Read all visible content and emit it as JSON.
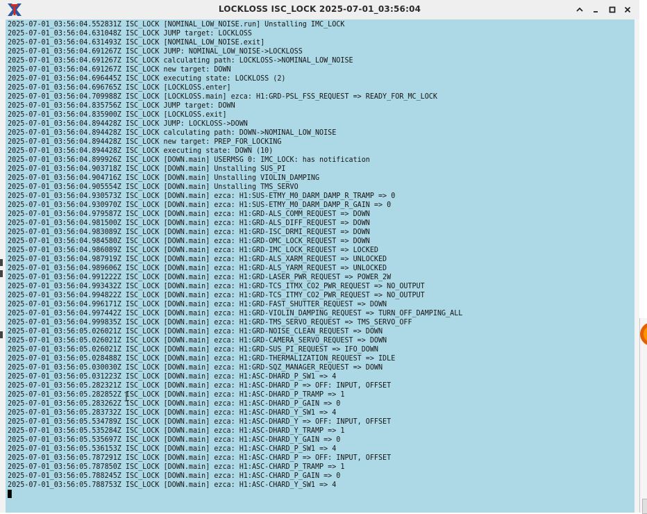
{
  "window": {
    "title": "LOCKLOSS ISC_LOCK 2025-07-01_03:56:04",
    "icons": {
      "app": "x-terminal-icon",
      "collapse": "chevron-up-icon",
      "minimize": "minimize-icon",
      "maximize": "maximize-icon",
      "close": "close-icon"
    }
  },
  "log": {
    "lines": [
      "2025-07-01_03:56:04.552831Z ISC_LOCK [NOMINAL_LOW_NOISE.run] Unstalling IMC_LOCK",
      "2025-07-01_03:56:04.631048Z ISC_LOCK JUMP target: LOCKLOSS",
      "2025-07-01_03:56:04.631493Z ISC_LOCK [NOMINAL_LOW_NOISE.exit]",
      "2025-07-01_03:56:04.691267Z ISC_LOCK JUMP: NOMINAL_LOW_NOISE->LOCKLOSS",
      "2025-07-01_03:56:04.691267Z ISC_LOCK calculating path: LOCKLOSS->NOMINAL_LOW_NOISE",
      "2025-07-01_03:56:04.691267Z ISC_LOCK new target: DOWN",
      "2025-07-01_03:56:04.696445Z ISC_LOCK executing state: LOCKLOSS (2)",
      "2025-07-01_03:56:04.696765Z ISC_LOCK [LOCKLOSS.enter]",
      "2025-07-01_03:56:04.709988Z ISC_LOCK [LOCKLOSS.main] ezca: H1:GRD-PSL_FSS_REQUEST => READY_FOR_MC_LOCK",
      "2025-07-01_03:56:04.835756Z ISC_LOCK JUMP target: DOWN",
      "2025-07-01_03:56:04.835900Z ISC_LOCK [LOCKLOSS.exit]",
      "2025-07-01_03:56:04.894428Z ISC_LOCK JUMP: LOCKLOSS->DOWN",
      "2025-07-01_03:56:04.894428Z ISC_LOCK calculating path: DOWN->NOMINAL_LOW_NOISE",
      "2025-07-01_03:56:04.894428Z ISC_LOCK new target: PREP_FOR_LOCKING",
      "2025-07-01_03:56:04.894428Z ISC_LOCK executing state: DOWN (10)",
      "2025-07-01_03:56:04.899926Z ISC_LOCK [DOWN.main] USERMSG 0: IMC_LOCK: has notification",
      "2025-07-01_03:56:04.903718Z ISC_LOCK [DOWN.main] Unstalling SUS_PI",
      "2025-07-01_03:56:04.904716Z ISC_LOCK [DOWN.main] Unstalling VIOLIN_DAMPING",
      "2025-07-01_03:56:04.905554Z ISC_LOCK [DOWN.main] Unstalling TMS_SERVO",
      "2025-07-01_03:56:04.930573Z ISC_LOCK [DOWN.main] ezca: H1:SUS-ETMY_M0_DARM_DAMP_R_TRAMP => 0",
      "2025-07-01_03:56:04.930970Z ISC_LOCK [DOWN.main] ezca: H1:SUS-ETMY_M0_DARM_DAMP_R_GAIN => 0",
      "2025-07-01_03:56:04.979587Z ISC_LOCK [DOWN.main] ezca: H1:GRD-ALS_COMM_REQUEST => DOWN",
      "2025-07-01_03:56:04.981500Z ISC_LOCK [DOWN.main] ezca: H1:GRD-ALS_DIFF_REQUEST => DOWN",
      "2025-07-01_03:56:04.983089Z ISC_LOCK [DOWN.main] ezca: H1:GRD-ISC_DRMI_REQUEST => DOWN",
      "2025-07-01_03:56:04.984580Z ISC_LOCK [DOWN.main] ezca: H1:GRD-OMC_LOCK_REQUEST => DOWN",
      "2025-07-01_03:56:04.986089Z ISC_LOCK [DOWN.main] ezca: H1:GRD-IMC_LOCK_REQUEST => LOCKED",
      "2025-07-01_03:56:04.987919Z ISC_LOCK [DOWN.main] ezca: H1:GRD-ALS_XARM_REQUEST => UNLOCKED",
      "2025-07-01_03:56:04.989606Z ISC_LOCK [DOWN.main] ezca: H1:GRD-ALS_YARM_REQUEST => UNLOCKED",
      "2025-07-01_03:56:04.991222Z ISC_LOCK [DOWN.main] ezca: H1:GRD-LASER_PWR_REQUEST => POWER_2W",
      "2025-07-01_03:56:04.993432Z ISC_LOCK [DOWN.main] ezca: H1:GRD-TCS_ITMX_CO2_PWR_REQUEST => NO_OUTPUT",
      "2025-07-01_03:56:04.994822Z ISC_LOCK [DOWN.main] ezca: H1:GRD-TCS_ITMY_CO2_PWR_REQUEST => NO_OUTPUT",
      "2025-07-01_03:56:04.996171Z ISC_LOCK [DOWN.main] ezca: H1:GRD-FAST_SHUTTER_REQUEST => DOWN",
      "2025-07-01_03:56:04.997442Z ISC_LOCK [DOWN.main] ezca: H1:GRD-VIOLIN_DAMPING_REQUEST => TURN_OFF_DAMPING_ALL",
      "2025-07-01_03:56:04.999835Z ISC_LOCK [DOWN.main] ezca: H1:GRD-TMS_SERVO_REQUEST => TMS_SERVO_OFF",
      "2025-07-01_03:56:05.026021Z ISC_LOCK [DOWN.main] ezca: H1:GRD-NOISE_CLEAN_REQUEST => DOWN",
      "2025-07-01_03:56:05.026021Z ISC_LOCK [DOWN.main] ezca: H1:GRD-CAMERA_SERVO_REQUEST => DOWN",
      "2025-07-01_03:56:05.026021Z ISC_LOCK [DOWN.main] ezca: H1:GRD-SUS_PI_REQUEST => IFO_DOWN",
      "2025-07-01_03:56:05.028488Z ISC_LOCK [DOWN.main] ezca: H1:GRD-THERMALIZATION_REQUEST => IDLE",
      "2025-07-01_03:56:05.030030Z ISC_LOCK [DOWN.main] ezca: H1:GRD-SQZ_MANAGER_REQUEST => DOWN",
      "2025-07-01_03:56:05.031223Z ISC_LOCK [DOWN.main] ezca: H1:ASC-DHARD_P_SW1 => 4",
      "2025-07-01_03:56:05.282321Z ISC_LOCK [DOWN.main] ezca: H1:ASC-DHARD_P => OFF: INPUT, OFFSET",
      "2025-07-01_03:56:05.282852Z ISC_LOCK [DOWN.main] ezca: H1:ASC-DHARD_P_TRAMP => 1",
      "2025-07-01_03:56:05.283262Z ISC_LOCK [DOWN.main] ezca: H1:ASC-DHARD_P_GAIN => 0",
      "2025-07-01_03:56:05.283732Z ISC_LOCK [DOWN.main] ezca: H1:ASC-DHARD_Y_SW1 => 4",
      "2025-07-01_03:56:05.534789Z ISC_LOCK [DOWN.main] ezca: H1:ASC-DHARD_Y => OFF: INPUT, OFFSET",
      "2025-07-01_03:56:05.535284Z ISC_LOCK [DOWN.main] ezca: H1:ASC-DHARD_Y_TRAMP => 1",
      "2025-07-01_03:56:05.535697Z ISC_LOCK [DOWN.main] ezca: H1:ASC-DHARD_Y_GAIN => 0",
      "2025-07-01_03:56:05.536153Z ISC_LOCK [DOWN.main] ezca: H1:ASC-CHARD_P_SW1 => 4",
      "2025-07-01_03:56:05.787291Z ISC_LOCK [DOWN.main] ezca: H1:ASC-CHARD_P => OFF: INPUT, OFFSET",
      "2025-07-01_03:56:05.787850Z ISC_LOCK [DOWN.main] ezca: H1:ASC-CHARD_P_TRAMP => 1",
      "2025-07-01_03:56:05.788245Z ISC_LOCK [DOWN.main] ezca: H1:ASC-CHARD_P_GAIN => 0",
      "2025-07-01_03:56:05.788753Z ISC_LOCK [DOWN.main] ezca: H1:ASC-CHARD_Y_SW1 => 4"
    ]
  },
  "colors": {
    "terminal_bg": "#add8e6",
    "text": "#141414",
    "titlebar_bg": "#efefef"
  }
}
